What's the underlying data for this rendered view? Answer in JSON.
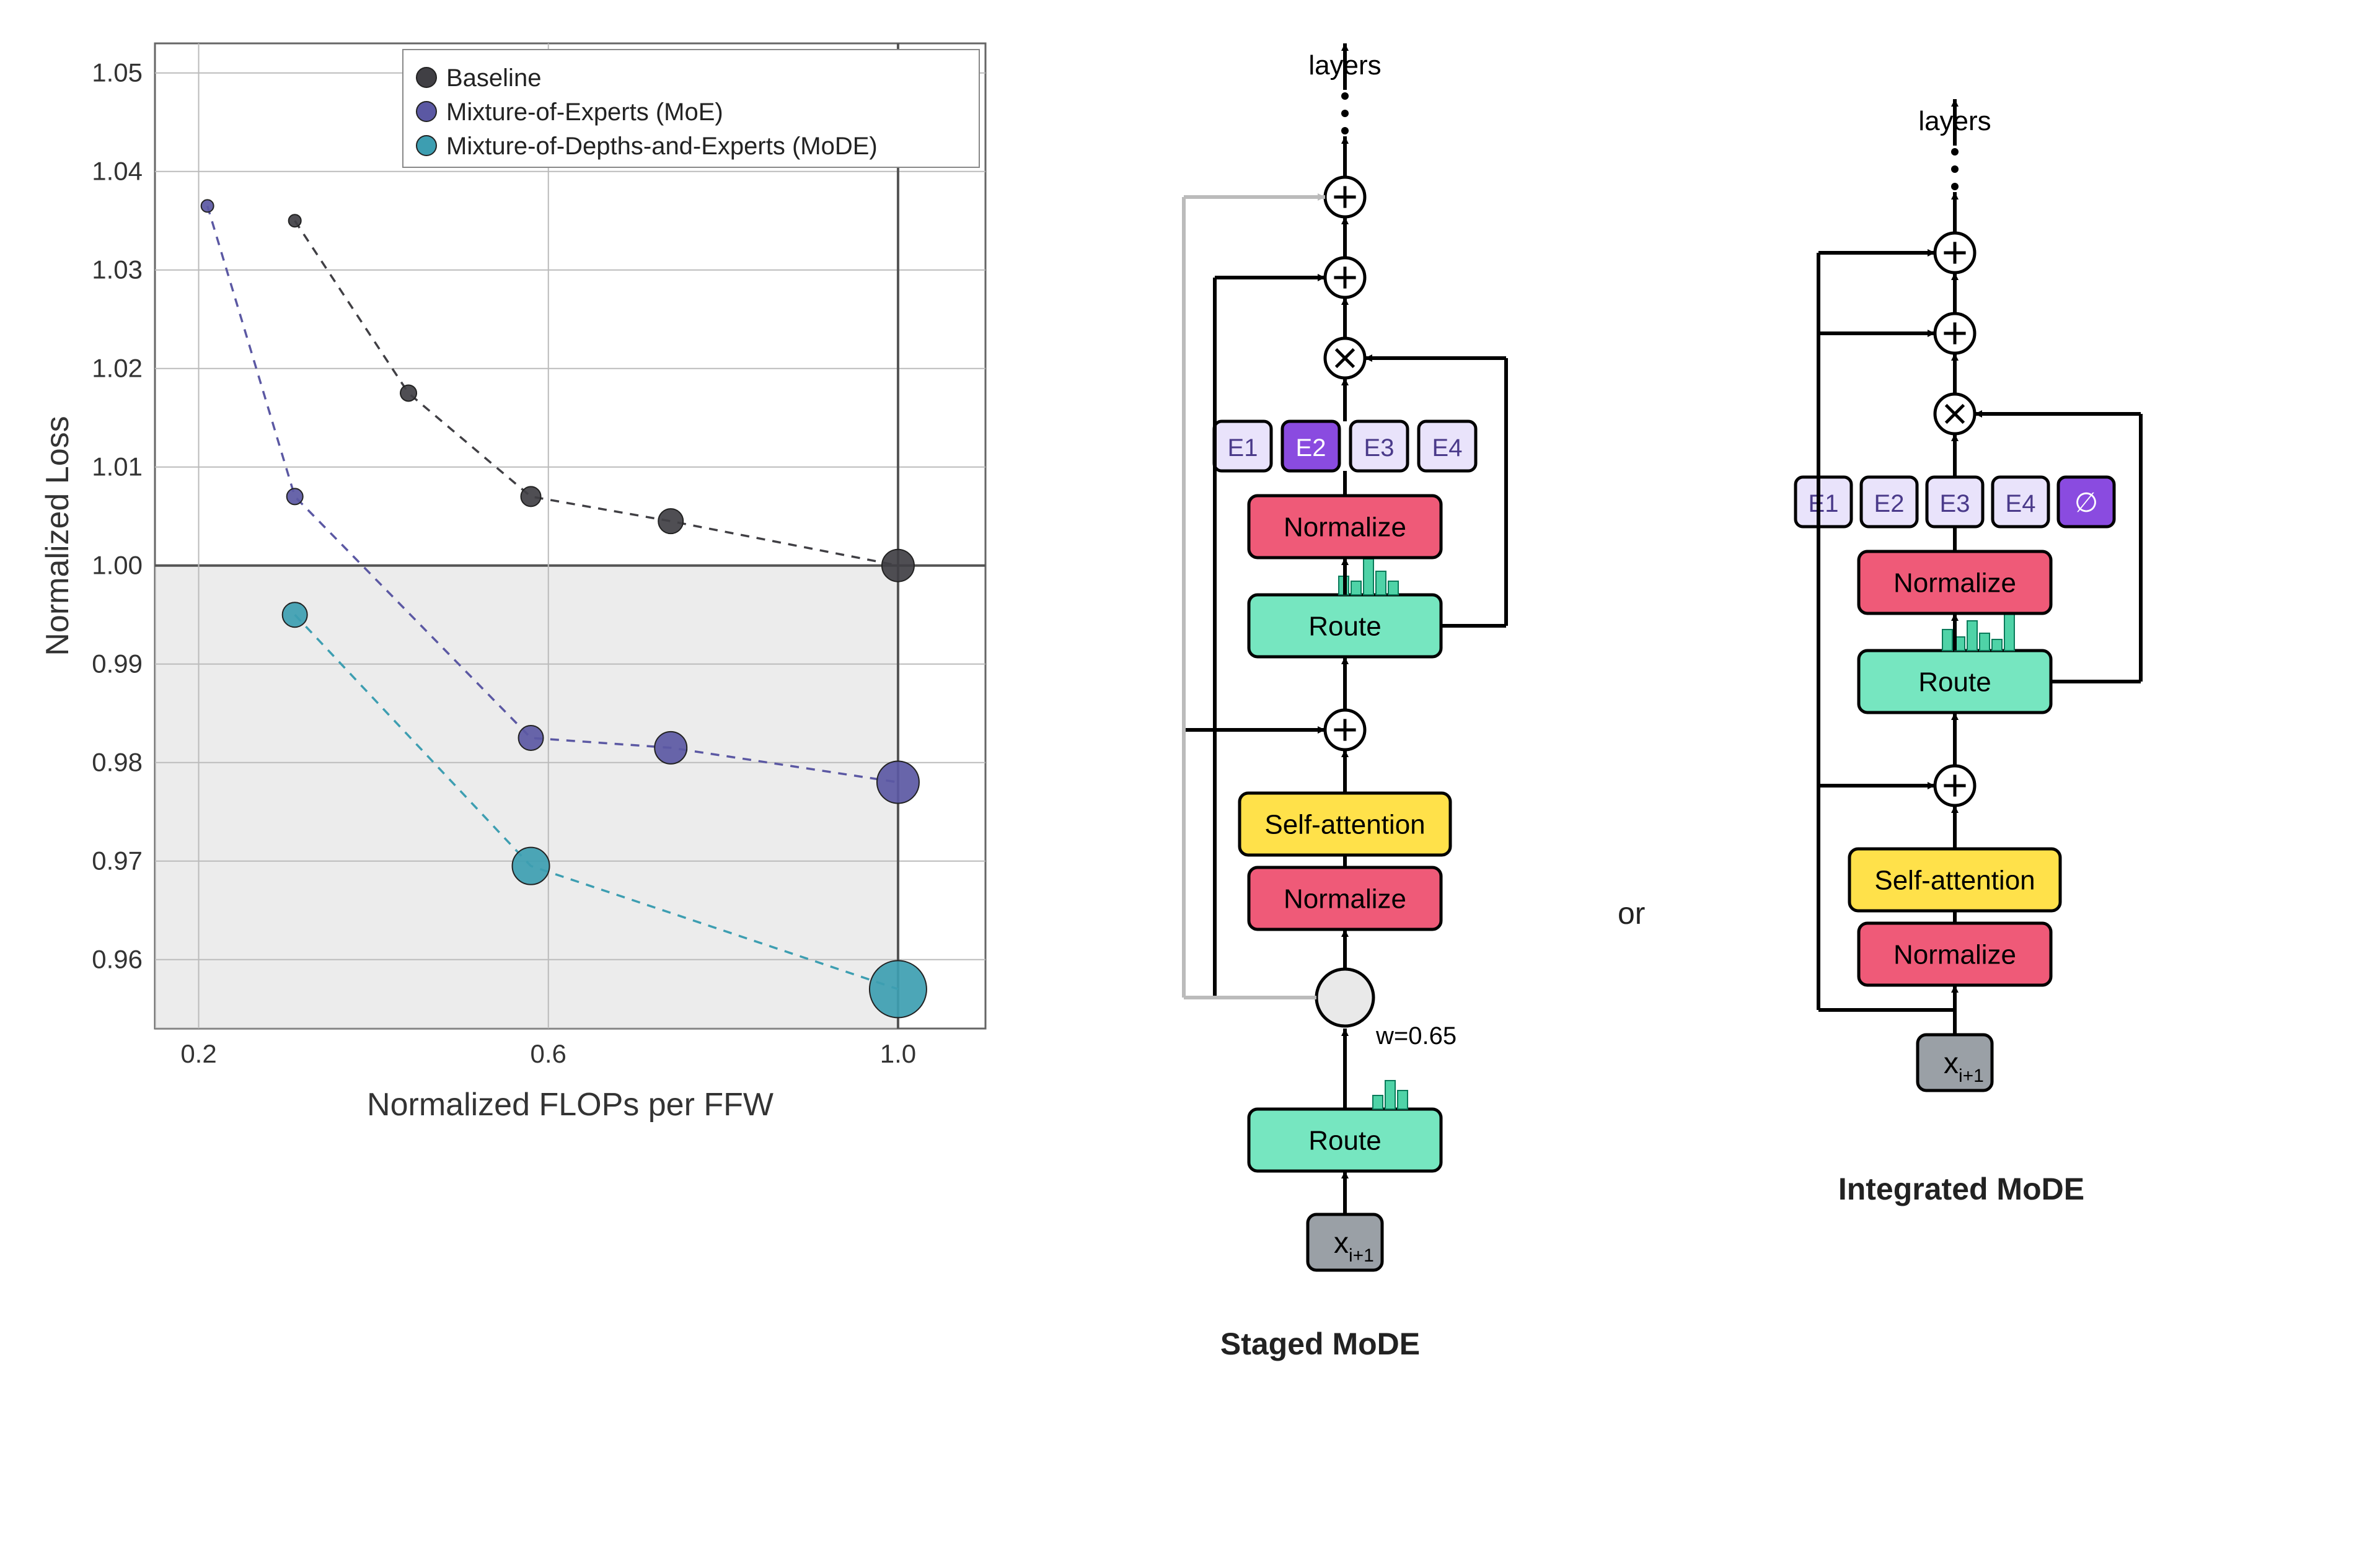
{
  "chart_data": {
    "type": "scatter",
    "title": "",
    "xlabel": "Normalized FLOPs per FFW",
    "ylabel": "Normalized Loss",
    "xlim": [
      0.15,
      1.1
    ],
    "ylim": [
      0.953,
      1.053
    ],
    "xticks": [
      0.2,
      0.6,
      1.0
    ],
    "yticks": [
      0.96,
      0.97,
      0.98,
      0.99,
      1.0,
      1.01,
      1.02,
      1.03,
      1.04,
      1.05
    ],
    "series": [
      {
        "name": "Baseline",
        "color": "#403f44",
        "points": [
          {
            "x": 0.31,
            "y": 1.035,
            "r": 10
          },
          {
            "x": 0.44,
            "y": 1.0175,
            "r": 13
          },
          {
            "x": 0.58,
            "y": 1.007,
            "r": 16
          },
          {
            "x": 0.74,
            "y": 1.0045,
            "r": 20
          },
          {
            "x": 1.0,
            "y": 1.0,
            "r": 26
          }
        ]
      },
      {
        "name": "Mixture-of-Experts (MoE)",
        "color": "#5b58a3",
        "points": [
          {
            "x": 0.21,
            "y": 1.0365,
            "r": 10
          },
          {
            "x": 0.31,
            "y": 1.007,
            "r": 13
          },
          {
            "x": 0.58,
            "y": 0.9825,
            "r": 20
          },
          {
            "x": 0.74,
            "y": 0.9815,
            "r": 26
          },
          {
            "x": 1.0,
            "y": 0.978,
            "r": 34
          }
        ]
      },
      {
        "name": "Mixture-of-Depths-and-Experts (MoDE)",
        "color": "#3d9eb1",
        "points": [
          {
            "x": 0.31,
            "y": 0.995,
            "r": 20
          },
          {
            "x": 0.58,
            "y": 0.9695,
            "r": 30
          },
          {
            "x": 1.0,
            "y": 0.957,
            "r": 46
          }
        ]
      }
    ],
    "shaded_region": {
      "x0": 0.15,
      "x1": 1.0,
      "y0": 0.953,
      "y1": 1.0
    }
  },
  "legend": {
    "items": [
      {
        "label": "Baseline",
        "color": "#403f44"
      },
      {
        "label": "Mixture-of-Experts (MoE)",
        "color": "#5b58a3"
      },
      {
        "label": "Mixture-of-Depths-and-Experts (MoDE)",
        "color": "#3d9eb1"
      }
    ]
  },
  "diagrams": {
    "layers_label": "layers",
    "or_label": "or",
    "staged": {
      "title": "Staged MoDE",
      "input": "x",
      "input_sub": "i+1",
      "weight_label": "w=0.65",
      "blocks": {
        "route": "Route",
        "normalize": "Normalize",
        "selfattn": "Self-attention",
        "experts": [
          "E1",
          "E2",
          "E3",
          "E4"
        ]
      }
    },
    "integrated": {
      "title": "Integrated MoDE",
      "input": "x",
      "input_sub": "i+1",
      "blocks": {
        "route": "Route",
        "normalize": "Normalize",
        "selfattn": "Self-attention",
        "experts": [
          "E1",
          "E2",
          "E3",
          "E4"
        ],
        "noop": "∅"
      }
    }
  }
}
